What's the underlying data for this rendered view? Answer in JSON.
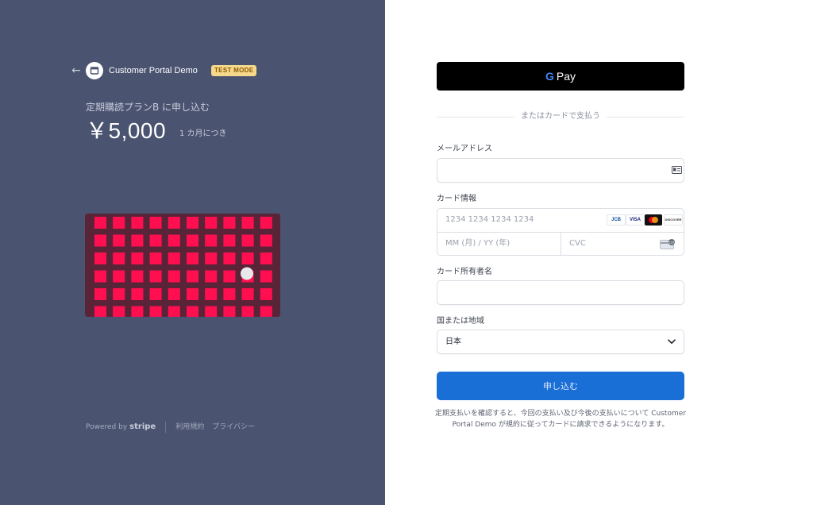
{
  "header": {
    "back_icon": "arrow-left-icon",
    "logo_icon": "store-icon",
    "brand": "Customer Portal Demo",
    "badge": "TEST MODE"
  },
  "product": {
    "plan": "定期購読プランB に申し込む",
    "price": "￥5,000",
    "period": "1 カ月につき"
  },
  "image": {
    "colors": {
      "background": "#5a2438",
      "tile": "#ff0f4f",
      "dot": "#e8e8ec"
    },
    "rows": 6,
    "cols": 10
  },
  "footer": {
    "powered": "Powered by",
    "stripe": "stripe",
    "terms": "利用規約",
    "privacy": "プライバシー"
  },
  "form": {
    "gpay_g": "G",
    "gpay_label": "Pay",
    "divider": "またはカードで支払う",
    "email_label": "メールアドレス",
    "email_value": "",
    "email_icon": "contact-card-icon",
    "card_label": "カード情報",
    "card_number_placeholder": "1234 1234 1234 1234",
    "card_brands": [
      "JCB",
      "VISA",
      "mastercard",
      "DISCOVER"
    ],
    "expiry_placeholder": "MM (月) / YY (年)",
    "cvc_placeholder": "CVC",
    "cvc_icon": "cvc-card-icon",
    "name_label": "カード所有者名",
    "name_value": "",
    "country_label": "国または地域",
    "country_value": "日本",
    "chevron_icon": "chevron-down-icon",
    "submit": "申し込む",
    "terms_text": "定期支払いを確認すると、今回の支払い及び今後の支払いについて Customer Portal Demo が規約に従ってカードに請求できるようになります。"
  },
  "colors": {
    "left_bg": "#4a5370",
    "submit": "#1a6fd6",
    "badge_bg": "#f6d98b",
    "badge_text": "#8c5a0a"
  }
}
